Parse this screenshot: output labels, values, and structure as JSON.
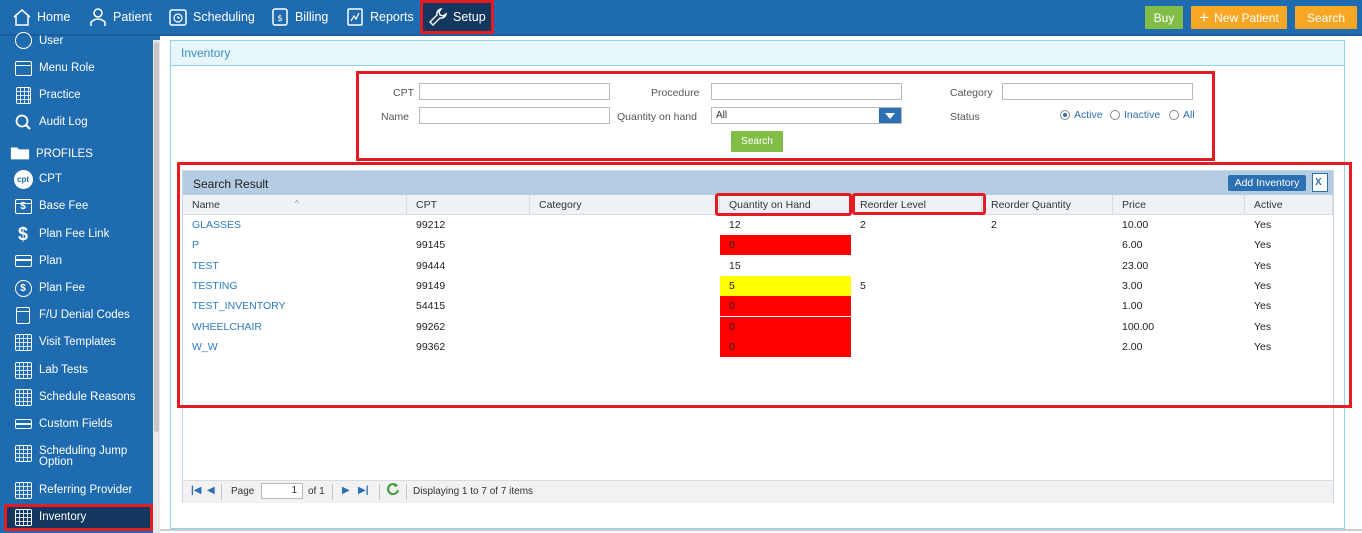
{
  "topnav": {
    "items": [
      {
        "label": "Home",
        "icon": "home-icon"
      },
      {
        "label": "Patient",
        "icon": "person-icon"
      },
      {
        "label": "Scheduling",
        "icon": "clock-icon"
      },
      {
        "label": "Billing",
        "icon": "billing-icon"
      },
      {
        "label": "Reports",
        "icon": "chart-icon"
      },
      {
        "label": "Setup",
        "icon": "wrench-icon"
      }
    ],
    "buy_label": "Buy",
    "new_patient_label": "New Patient",
    "search_label": "Search"
  },
  "sidebar": {
    "items": [
      {
        "label": "User"
      },
      {
        "label": "Menu Role"
      },
      {
        "label": "Practice"
      },
      {
        "label": "Audit Log"
      },
      {
        "label": "PROFILES"
      },
      {
        "label": "CPT"
      },
      {
        "label": "Base Fee"
      },
      {
        "label": "Plan Fee Link"
      },
      {
        "label": "Plan"
      },
      {
        "label": "Plan Fee"
      },
      {
        "label": "F/U Denial Codes"
      },
      {
        "label": "Visit Templates"
      },
      {
        "label": "Lab Tests"
      },
      {
        "label": "Schedule Reasons"
      },
      {
        "label": "Custom Fields"
      },
      {
        "label": "Scheduling Jump",
        "label2": "Option"
      },
      {
        "label": "Referring Provider"
      },
      {
        "label": "Inventory"
      }
    ]
  },
  "main": {
    "title": "Inventory",
    "filters": {
      "cpt_label": "CPT",
      "procedure_label": "Procedure",
      "category_label": "Category",
      "name_label": "Name",
      "qoh_label": "Quantity on hand",
      "qoh_value": "All",
      "status_label": "Status",
      "status_options": [
        "Active",
        "Inactive",
        "All"
      ],
      "status_selected": "Active",
      "search_label": "Search"
    },
    "grid": {
      "title": "Search Result",
      "add_label": "Add Inventory",
      "columns": [
        "Name",
        "CPT",
        "Category",
        "Quantity on Hand",
        "Reorder Level",
        "Reorder Quantity",
        "Price",
        "Active"
      ],
      "rows": [
        {
          "name": "GLASSES",
          "cpt": "99212",
          "category": "",
          "qoh": "12",
          "reorder_level": "2",
          "reorder_qty": "2",
          "price": "10.00",
          "active": "Yes",
          "status": "normal"
        },
        {
          "name": "P",
          "cpt": "99145",
          "category": "",
          "qoh": "0",
          "reorder_level": "",
          "reorder_qty": "",
          "price": "6.00",
          "active": "Yes",
          "status": "red"
        },
        {
          "name": "TEST",
          "cpt": "99444",
          "category": "",
          "qoh": "15",
          "reorder_level": "",
          "reorder_qty": "",
          "price": "23.00",
          "active": "Yes",
          "status": "normal"
        },
        {
          "name": "TESTING",
          "cpt": "99149",
          "category": "",
          "qoh": "5",
          "reorder_level": "5",
          "reorder_qty": "",
          "price": "3.00",
          "active": "Yes",
          "status": "yellow"
        },
        {
          "name": "TEST_INVENTORY",
          "cpt": "54415",
          "category": "",
          "qoh": "0",
          "reorder_level": "",
          "reorder_qty": "",
          "price": "1.00",
          "active": "Yes",
          "status": "red"
        },
        {
          "name": "WHEELCHAIR",
          "cpt": "99262",
          "category": "",
          "qoh": "0",
          "reorder_level": "",
          "reorder_qty": "",
          "price": "100.00",
          "active": "Yes",
          "status": "red"
        },
        {
          "name": "W_W",
          "cpt": "99362",
          "category": "",
          "qoh": "0",
          "reorder_level": "",
          "reorder_qty": "",
          "price": "2.00",
          "active": "Yes",
          "status": "red"
        }
      ]
    },
    "pager": {
      "page_label": "Page",
      "page_value": "1",
      "of_label": "of 1",
      "summary": "Displaying 1 to 7 of 7 items"
    }
  },
  "colors": {
    "nav_blue": "#1f6bb0",
    "highlight_red": "#e31b23",
    "low_stock": "#ff0000",
    "reorder_warn": "#ffff00",
    "buy_green": "#82bd47",
    "accent_orange": "#f7a723"
  }
}
